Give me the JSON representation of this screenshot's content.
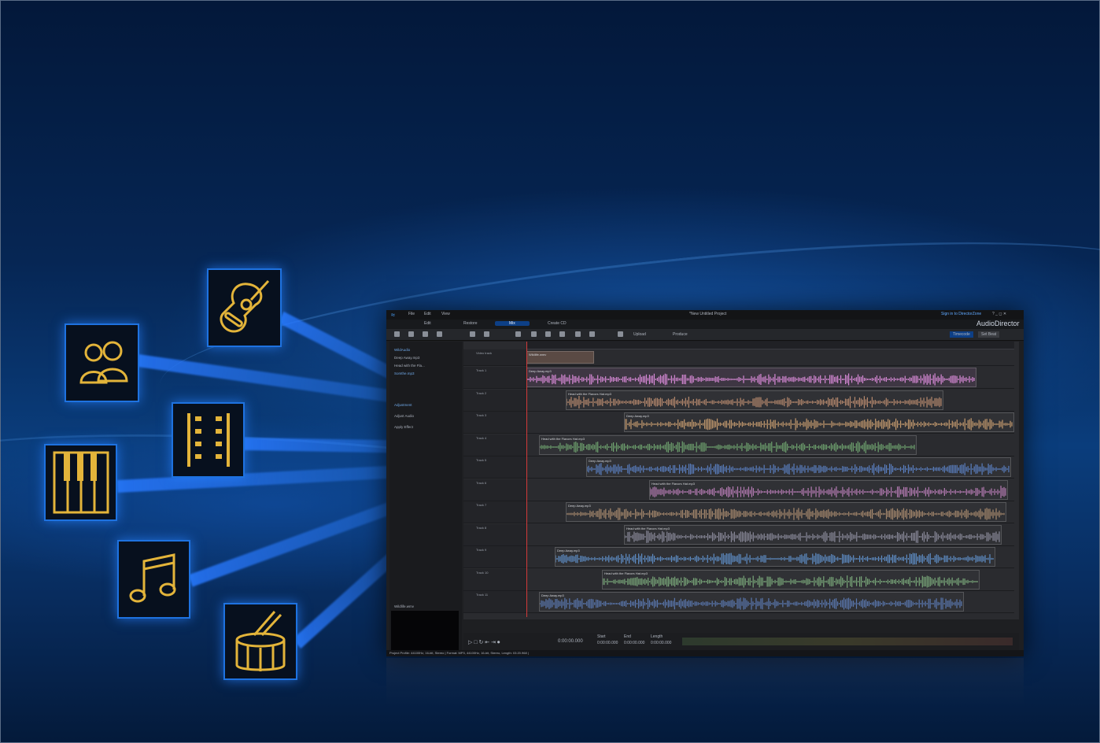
{
  "app": {
    "window_title": "*New Untitled Project",
    "brand": "AudioDirector",
    "sign_in": "Sign in to DirectorZone",
    "menu": [
      "File",
      "Edit",
      "View"
    ],
    "modes": [
      "Edit",
      "Restore",
      "Mix",
      "Create CD"
    ],
    "active_mode": "Mix",
    "toolbar_labels": [
      "Upload",
      "Produce"
    ],
    "timecode_toggle": [
      "Timecode",
      "Set Beat"
    ],
    "library_items": [
      "WildAudio",
      "Deep Away.mp3",
      "Head with the Fla...",
      "Somthe.mp3"
    ],
    "panel_header": "Adjustment",
    "panel_items": [
      "Adjust Audio",
      "Apply Effect"
    ],
    "preview_label": "Wildlife.wmv",
    "video_track": {
      "name": "Video track",
      "clip": "Wildlife.wmv"
    },
    "transport": {
      "time": "0:00:00.000",
      "start_label": "Start",
      "end_label": "End",
      "length_label": "Length",
      "start": "0:00:00.000",
      "end": "0:00:00.000",
      "length": "0:00:00.000"
    },
    "status": "Project Profile: 44100Hz, 16-bit, Stereo | Format: MP3, 44100Hz, 16-bit, Stereo, Length: 03:20.968 |",
    "tracks": [
      {
        "name": "Track 1",
        "clip": "Deep Away.mp3",
        "color": "#d98ad8"
      },
      {
        "name": "Track 2",
        "clip": "Head with the Flavors Hat.mp3",
        "color": "#b88a6e"
      },
      {
        "name": "Track 3",
        "clip": "Deep Away.mp3",
        "color": "#c49a6e"
      },
      {
        "name": "Track 4",
        "clip": "Head with the Flavors Hat.mp3",
        "color": "#6fa36f"
      },
      {
        "name": "Track 5",
        "clip": "Deep Away.mp3",
        "color": "#5a7fc0"
      },
      {
        "name": "Track 6",
        "clip": "Head with the Flavors Hat.mp3",
        "color": "#b57bb3"
      },
      {
        "name": "Track 7",
        "clip": "Deep Away.mp3",
        "color": "#a88a6e"
      },
      {
        "name": "Track 8",
        "clip": "Head with the Flavors Hat.mp3",
        "color": "#8a8a9a"
      },
      {
        "name": "Track 9",
        "clip": "Deep Away.mp3",
        "color": "#5f8fc8"
      },
      {
        "name": "Track 10",
        "clip": "Head with the Flavors Hat.mp3",
        "color": "#7aa87a"
      },
      {
        "name": "Track 11",
        "clip": "Deep Away.mp3",
        "color": "#5a78b0"
      }
    ]
  },
  "feature_icons": [
    "guitar-icon",
    "people-icon",
    "film-strip-icon",
    "piano-keys-icon",
    "music-note-icon",
    "drum-icon"
  ],
  "colors": {
    "accent": "#1e72e0",
    "icon_gold": "#e3b43a",
    "background": "#062654"
  }
}
